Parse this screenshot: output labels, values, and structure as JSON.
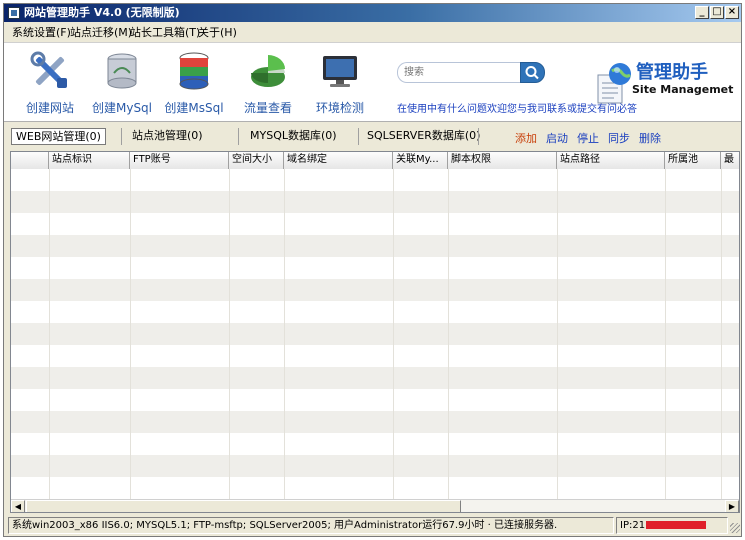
{
  "window": {
    "title": "网站管理助手 V4.0 (无限制版)",
    "minimize_glyph": "_",
    "maximize_glyph": "□",
    "close_glyph": "×"
  },
  "menu": [
    {
      "label": "系统设置(F)"
    },
    {
      "label": "站点迁移(M)"
    },
    {
      "label": "站长工具箱(T)"
    },
    {
      "label": "关于(H)"
    }
  ],
  "toolbar": {
    "buttons": [
      {
        "label": "创建网站",
        "icon": "tools-icon"
      },
      {
        "label": "创建MySql",
        "icon": "mysql-database-icon"
      },
      {
        "label": "创建MsSql",
        "icon": "mssql-database-icon"
      },
      {
        "label": "流量查看",
        "icon": "pie-chart-icon"
      },
      {
        "label": "环境检测",
        "icon": "monitor-icon"
      }
    ],
    "search_placeholder": "搜索",
    "help_text": "在使用中有什么问题欢迎您与我司联系或提交有问必答"
  },
  "brand": {
    "title": "管理助手",
    "subtitle": "Site Managemet"
  },
  "tabs": [
    {
      "label": "WEB网站管理(0)",
      "active": true
    },
    {
      "label": "站点池管理(0)"
    },
    {
      "label": "MYSQL数据库(0)"
    },
    {
      "label": "SQLSERVER数据库(0)"
    }
  ],
  "actions": [
    {
      "label": "添加",
      "color": "#c8400a"
    },
    {
      "label": "启动"
    },
    {
      "label": "停止"
    },
    {
      "label": "同步"
    },
    {
      "label": "删除"
    }
  ],
  "grid": {
    "columns": [
      "",
      "站点标识",
      "FTP账号",
      "空间大小",
      "域名绑定",
      "关联My...",
      "脚本权限",
      "站点路径",
      "所属池",
      "最"
    ],
    "rows": []
  },
  "statusbar": {
    "info": "系统win2003_x86 IIS6.0; MYSQL5.1; FTP-msftp; SQLServer2005; 用户Administrator运行67.9小时 · 已连接服务器.",
    "ip_label": "IP:21"
  },
  "colors": {
    "accent": "#2a5aa8",
    "link": "#1a3fbf",
    "highlight": "#c8400a"
  }
}
